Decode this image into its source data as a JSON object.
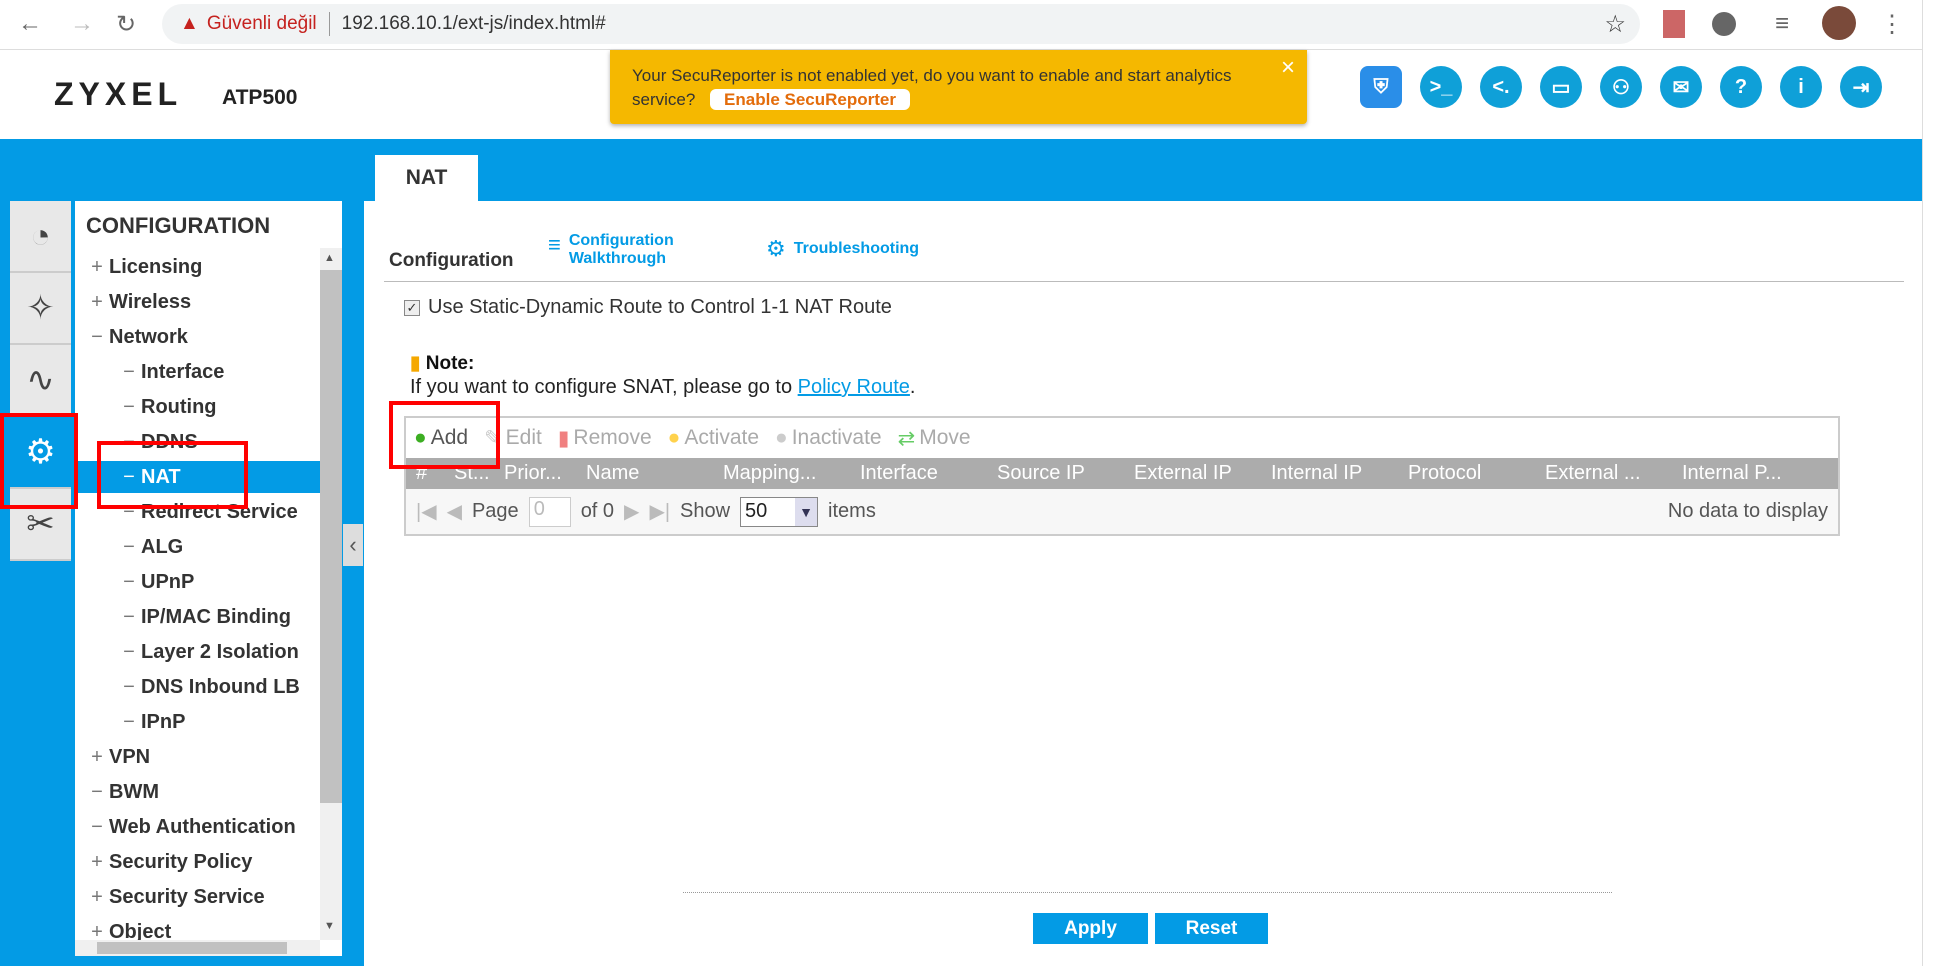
{
  "browser": {
    "security_label": "Güvenli değil",
    "url": "192.168.10.1/ext-js/index.html#"
  },
  "header": {
    "logo": "ZYXEL",
    "model": "ATP500",
    "notice": {
      "text": "Your SecuReporter is not enabled yet, do you want to enable and start analytics service?",
      "button": "Enable SecuReporter",
      "close": "×"
    },
    "icons": [
      "shield-icon",
      "console-icon",
      "cli-icon",
      "windows-icon",
      "sitemap-icon",
      "chat-icon",
      "help-icon",
      "info-icon",
      "logout-icon"
    ]
  },
  "tab": "NAT",
  "sidebar": {
    "title": "CONFIGURATION",
    "items": [
      {
        "pre": "+",
        "label": "Licensing",
        "level": 1
      },
      {
        "pre": "+",
        "label": "Wireless",
        "level": 1
      },
      {
        "pre": "−",
        "label": "Network",
        "level": 1
      },
      {
        "pre": "−",
        "label": "Interface",
        "level": 2
      },
      {
        "pre": "−",
        "label": "Routing",
        "level": 2
      },
      {
        "pre": "−",
        "label": "DDNS",
        "level": 2
      },
      {
        "pre": "−",
        "label": "NAT",
        "level": 2,
        "selected": true
      },
      {
        "pre": "−",
        "label": "Redirect Service",
        "level": 2
      },
      {
        "pre": "−",
        "label": "ALG",
        "level": 2
      },
      {
        "pre": "−",
        "label": "UPnP",
        "level": 2
      },
      {
        "pre": "−",
        "label": "IP/MAC Binding",
        "level": 2
      },
      {
        "pre": "−",
        "label": "Layer 2 Isolation",
        "level": 2
      },
      {
        "pre": "−",
        "label": "DNS Inbound LB",
        "level": 2
      },
      {
        "pre": "−",
        "label": "IPnP",
        "level": 2
      },
      {
        "pre": "+",
        "label": "VPN",
        "level": 1
      },
      {
        "pre": "−",
        "label": "BWM",
        "level": 1
      },
      {
        "pre": "−",
        "label": "Web Authentication",
        "level": 1
      },
      {
        "pre": "+",
        "label": "Security Policy",
        "level": 1
      },
      {
        "pre": "+",
        "label": "Security Service",
        "level": 1
      },
      {
        "pre": "+",
        "label": "Object",
        "level": 1
      }
    ]
  },
  "main": {
    "section": "Configuration",
    "walkthrough": "Configuration Walkthrough",
    "troubleshooting": "Troubleshooting",
    "checkbox_label": "Use Static-Dynamic Route to Control 1-1 NAT Route",
    "checkbox_checked": true,
    "note_title": "Note:",
    "note_text": "If you want to configure SNAT, please go to ",
    "note_link": "Policy Route",
    "note_end": ".",
    "toolbar": [
      "Add",
      "Edit",
      "Remove",
      "Activate",
      "Inactivate",
      "Move"
    ],
    "columns": [
      "#",
      "St...",
      "Prior...",
      "Name",
      "Mapping...",
      "Interface",
      "Source IP",
      "External IP",
      "Internal IP",
      "Protocol",
      "External ...",
      "Internal P..."
    ],
    "paging": {
      "page_label": "Page",
      "page_value": "0",
      "of": "of 0",
      "show": "Show",
      "page_size": "50",
      "items": "items",
      "empty": "No data to display"
    },
    "apply": "Apply",
    "reset": "Reset"
  },
  "colors": {
    "accent": "#039be5",
    "notice": "#f5b800",
    "highlight": "#ff0000"
  }
}
